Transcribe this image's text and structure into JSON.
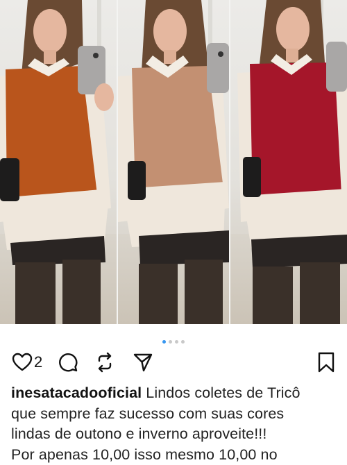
{
  "post": {
    "carousel": {
      "slide_count": 4,
      "active_index": 0
    },
    "likes_count": "2",
    "username": "inesatacadooficial",
    "caption_lines": [
      "Lindos coletes de Tricô",
      "que sempre faz sucesso com suas cores",
      "lindas de outono e inverno aproveite!!!",
      "Por apenas 10,00 isso mesmo 10,00 no"
    ],
    "vest_colors": [
      "#b9551c",
      "#c39072",
      "#a5162a"
    ]
  },
  "icons": [
    "heart-icon",
    "comment-icon",
    "repost-icon",
    "share-icon",
    "bookmark-icon"
  ]
}
